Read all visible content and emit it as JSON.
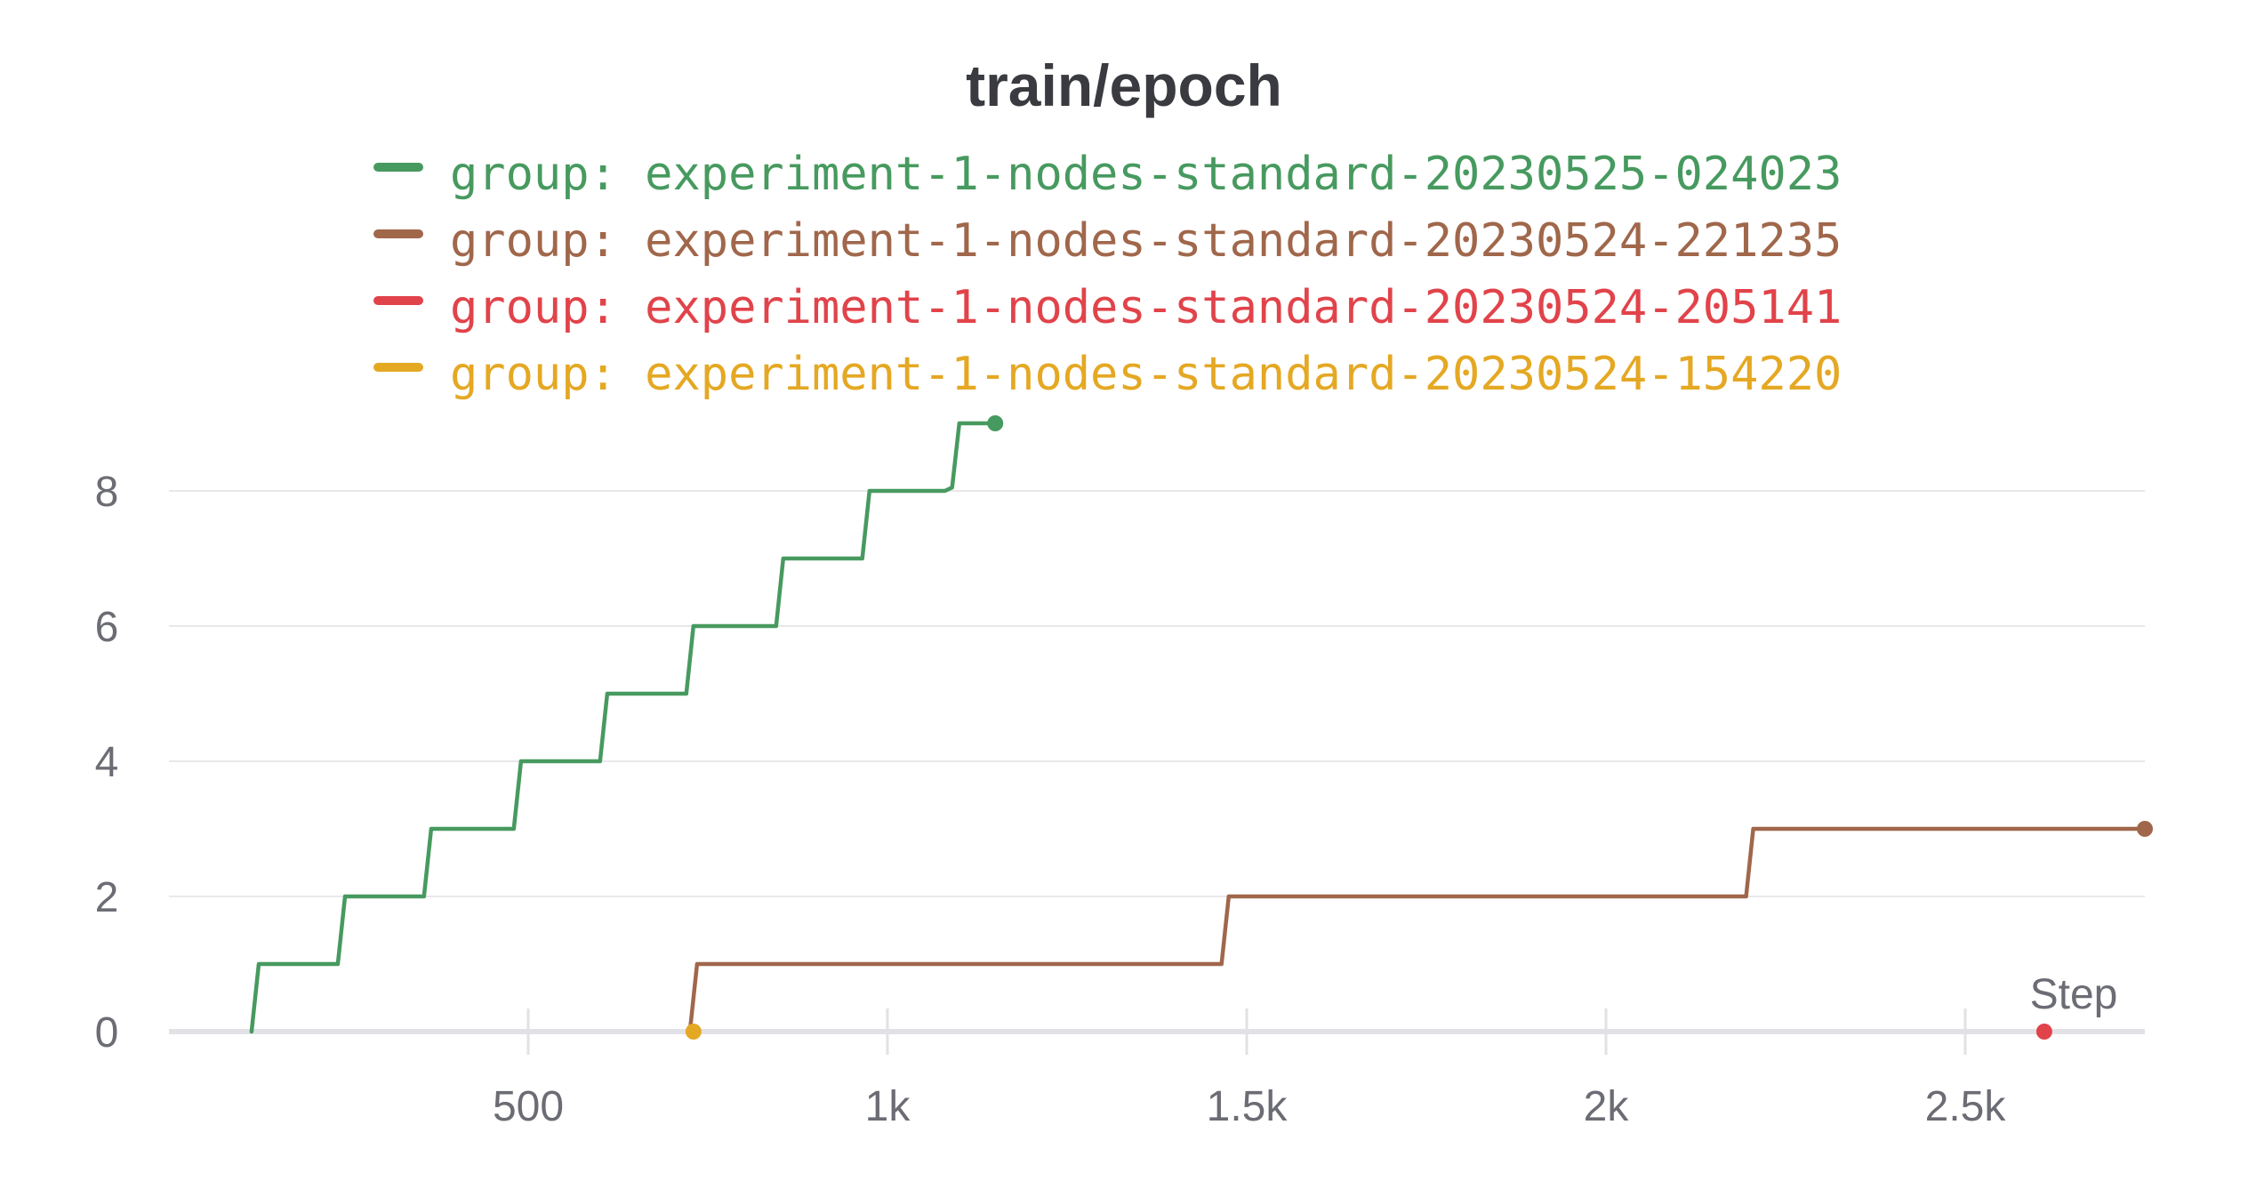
{
  "chart_data": {
    "type": "line",
    "title": "train/epoch",
    "xlabel": "Step",
    "ylabel": "",
    "xlim": [
      0,
      2750
    ],
    "ylim": [
      0,
      9
    ],
    "x_ticks": [
      500,
      1000,
      1500,
      2000,
      2500
    ],
    "x_tick_labels": [
      "500",
      "1k",
      "1.5k",
      "2k",
      "2.5k"
    ],
    "y_ticks": [
      0,
      2,
      4,
      6,
      8
    ],
    "y_tick_labels": [
      "0",
      "2",
      "4",
      "6",
      "8"
    ],
    "grid": true,
    "legend_position": "top",
    "series": [
      {
        "name": "group: experiment-1-nodes-standard-20230525-024023",
        "color": "#479a5f",
        "x": [
          115,
          125,
          235,
          245,
          355,
          365,
          480,
          490,
          600,
          610,
          720,
          730,
          845,
          855,
          965,
          975,
          1080,
          1090,
          1100,
          1110,
          1150
        ],
        "y": [
          0,
          1,
          1,
          2,
          2,
          3,
          3,
          4,
          4,
          5,
          5,
          6,
          6,
          7,
          7,
          8,
          8,
          8.05,
          9,
          9,
          9
        ]
      },
      {
        "name": "group: experiment-1-nodes-standard-20230524-221235",
        "color": "#a0674b",
        "x": [
          725,
          735,
          1465,
          1475,
          2195,
          2205,
          2750
        ],
        "y": [
          0,
          1,
          1,
          2,
          2,
          3,
          3
        ]
      },
      {
        "name": "group: experiment-1-nodes-standard-20230524-205141",
        "color": "#e1434a",
        "x": [
          2610
        ],
        "y": [
          0
        ]
      },
      {
        "name": "group: experiment-1-nodes-standard-20230524-154220",
        "color": "#e5a823",
        "x": [
          730
        ],
        "y": [
          0
        ]
      }
    ]
  }
}
